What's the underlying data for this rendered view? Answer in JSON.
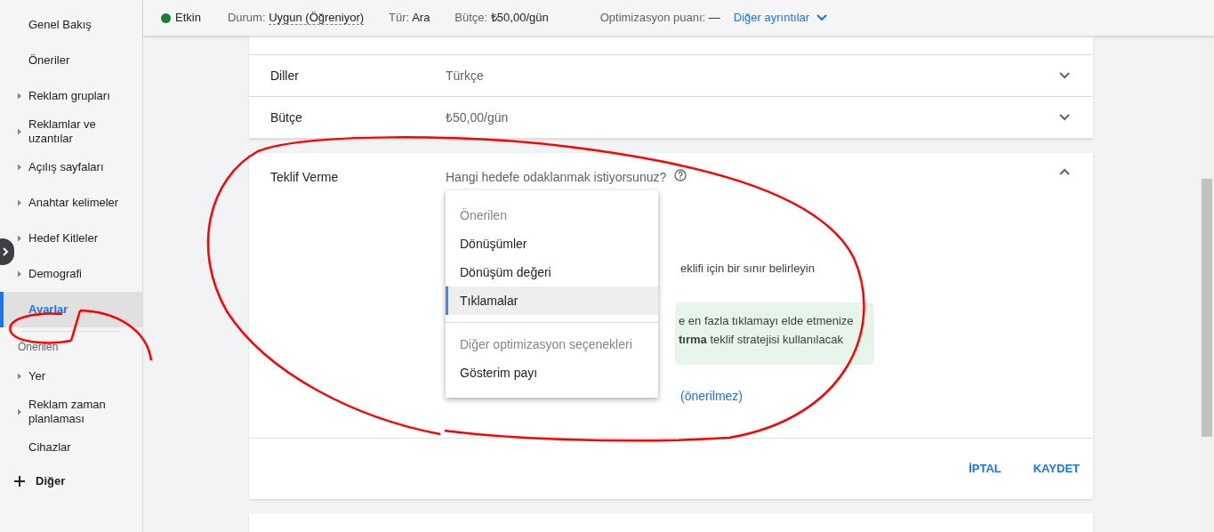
{
  "sidebar": {
    "items": [
      {
        "label": "Genel Bakış",
        "expandable": false,
        "selected": false
      },
      {
        "label": "Öneriler",
        "expandable": false,
        "selected": false
      },
      {
        "label": "Reklam grupları",
        "expandable": true,
        "selected": false
      },
      {
        "label": "Reklamlar ve uzantılar",
        "expandable": true,
        "selected": false
      },
      {
        "label": "Açılış sayfaları",
        "expandable": true,
        "selected": false
      },
      {
        "label": "Anahtar kelimeler",
        "expandable": true,
        "selected": false
      },
      {
        "label": "Hedef Kitleler",
        "expandable": true,
        "selected": false
      },
      {
        "label": "Demografi",
        "expandable": true,
        "selected": false
      },
      {
        "label": "Ayarlar",
        "expandable": false,
        "selected": true
      }
    ],
    "section_title": "Önerilen",
    "section_items": [
      {
        "label": "Yer",
        "expandable": true,
        "selected": false
      },
      {
        "label": "Reklam zaman planlaması",
        "expandable": true,
        "selected": false
      },
      {
        "label": "Cihazlar",
        "expandable": false,
        "selected": false
      }
    ],
    "more": "Diğer"
  },
  "status_bar": {
    "status": {
      "label": "Etkin",
      "color": "#188038"
    },
    "fields": [
      {
        "name": "Durum:",
        "value": "Uygun (Öğreniyor)"
      },
      {
        "name": "Tür:",
        "value": "Ara"
      },
      {
        "name": "Bütçe:",
        "value": "₺50,00/gün"
      }
    ],
    "score": {
      "name": "Optimizasyon puanı:",
      "value": "—"
    },
    "details_link": "Diğer ayrıntılar"
  },
  "settings": [
    {
      "name": "Diller",
      "value": "Türkçe"
    },
    {
      "name": "Bütçe",
      "value": "₺50,00/gün"
    }
  ],
  "bidding": {
    "title": "Teklif Verme",
    "question": "Hangi hedefe odaklanmak istiyorsunuz?",
    "hidden_text": "eklifi için bir sınır belirleyin",
    "info_lines": [
      "e en fazla tıklamayı elde etmenize",
      "**tırma** teklif stratejisi kullanılacak"
    ],
    "link": "(önerilmez)",
    "menu": [
      {
        "kind": "header",
        "label": "Önerilen"
      },
      {
        "kind": "option",
        "label": "Dönüşümler",
        "selected": false
      },
      {
        "kind": "option",
        "label": "Dönüşüm değeri",
        "selected": false
      },
      {
        "kind": "option",
        "label": "Tıklamalar",
        "selected": true
      },
      {
        "kind": "divider"
      },
      {
        "kind": "header",
        "label": "Diğer optimizasyon seçenekleri"
      },
      {
        "kind": "option",
        "label": "Gösterim payı",
        "selected": false
      }
    ],
    "buttons": [
      "İPTAL",
      "KAYDET"
    ]
  }
}
